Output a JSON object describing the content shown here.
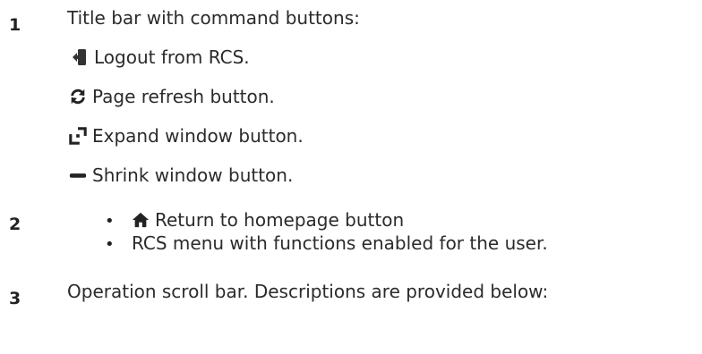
{
  "items": [
    {
      "number": "1",
      "title": "Title bar with command buttons:",
      "sub": [
        {
          "icon": "logout-icon",
          "label": "Logout from RCS."
        },
        {
          "icon": "refresh-icon",
          "label": "Page refresh button."
        },
        {
          "icon": "expand-window-icon",
          "label": "Expand window button."
        },
        {
          "icon": "shrink-window-icon",
          "label": "Shrink window button."
        }
      ]
    },
    {
      "number": "2",
      "bullets": [
        {
          "icon": "home-icon",
          "label": "Return to homepage button"
        },
        {
          "label": "RCS menu with functions enabled for the user."
        }
      ]
    },
    {
      "number": "3",
      "title": "Operation scroll bar. Descriptions are provided below:"
    }
  ]
}
